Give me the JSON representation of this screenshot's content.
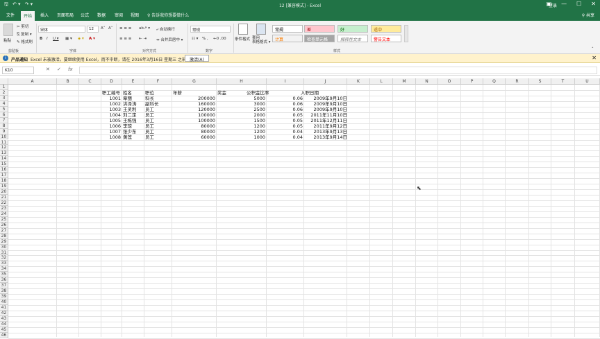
{
  "titlebar": {
    "save_icon": "save-icon",
    "undo_icon": "undo-icon",
    "redo_icon": "redo-icon",
    "title": "12 [兼容模式] - Excel",
    "login": "登录",
    "min": "—",
    "max": "☐",
    "close": "✕"
  },
  "tabs": {
    "items": [
      "文件",
      "开始",
      "插入",
      "页面布局",
      "公式",
      "数据",
      "审阅",
      "视图"
    ],
    "tell": "♀ 告诉我你想要做什么",
    "share": "⚲ 共享"
  },
  "ribbon": {
    "paste": "粘贴",
    "cut": "✂ 剪切",
    "copy": "⎘ 复制 ▾",
    "painter": "✎ 格式刷",
    "font_name": "宋体",
    "font_size": "12",
    "grow": "A˄",
    "shrink": "A˅",
    "bold": "B",
    "italic": "I",
    "underline": "U ▾",
    "wrap": "⤶ 自动换行",
    "merge": "⇔ 合并后居中 ▾",
    "number_format": "常规",
    "percent": "% ,",
    "dec": "←0 .00",
    "cond_format": "条件格式",
    "table_format": "套用\n表格格式 ▾",
    "styles": [
      {
        "label": "常规",
        "bg": "#ffffff",
        "fg": "#000000"
      },
      {
        "label": "差",
        "bg": "#ffc7ce",
        "fg": "#9c0006"
      },
      {
        "label": "好",
        "bg": "#c6efce",
        "fg": "#006100"
      },
      {
        "label": "适中",
        "bg": "#ffeb9c",
        "fg": "#9c5700"
      },
      {
        "label": "计算",
        "bg": "#f2f2f2",
        "fg": "#fa7d00"
      },
      {
        "label": "检查单元格",
        "bg": "#a5a5a5",
        "fg": "#ffffff"
      },
      {
        "label": "解释性文本",
        "bg": "#ffffff",
        "fg": "#7f7f7f"
      },
      {
        "label": "警告文本",
        "bg": "#ffffff",
        "fg": "#ff0000"
      }
    ],
    "groups": {
      "clipboard": "剪贴板",
      "font": "字体",
      "align": "对齐方式",
      "number": "数字",
      "styles": "样式"
    }
  },
  "notice": {
    "title": "产品通知",
    "text": "Excel 未被激活。要继续使用 Excel，而不中断，请在 2016年3月16日 星期三 之前激活。",
    "button": "激活(A)",
    "close": "✕"
  },
  "formula_bar": {
    "name_box": "K10",
    "cancel": "✕",
    "enter": "✓",
    "fx": "fx",
    "value": ""
  },
  "columns": [
    "A",
    "B",
    "C",
    "D",
    "E",
    "F",
    "G",
    "H",
    "I",
    "J",
    "K",
    "L",
    "M",
    "N",
    "O",
    "P",
    "Q",
    "R",
    "S",
    "T",
    "U"
  ],
  "rows": [
    "1",
    "2",
    "3",
    "4",
    "5",
    "6",
    "7",
    "8",
    "9",
    "10",
    "11",
    "12",
    "13",
    "14",
    "15",
    "16",
    "17",
    "18",
    "19",
    "20",
    "21",
    "22",
    "23",
    "24",
    "25",
    "26",
    "27",
    "28",
    "29",
    "30",
    "31",
    "32",
    "33",
    "34",
    "35",
    "36",
    "37",
    "38",
    "39",
    "40",
    "41",
    "42",
    "43",
    "44",
    "45",
    "46"
  ],
  "sheet": {
    "headers": [
      "职工编号",
      "姓名",
      "职位",
      "年薪",
      "奖金",
      "公积金比率",
      "入职日期"
    ],
    "rows": [
      [
        "1001",
        "章丽",
        "科长",
        "200000",
        "5000",
        "0.06",
        "2009年9月10日"
      ],
      [
        "1002",
        "洪泽涛",
        "副科长",
        "160000",
        "3000",
        "0.06",
        "2009年9月10日"
      ],
      [
        "1003",
        "王灵利",
        "员工",
        "120000",
        "2500",
        "0.06",
        "2009年9月10日"
      ],
      [
        "1004",
        "刘二定",
        "员工",
        "100000",
        "2000",
        "0.05",
        "2011年11月10日"
      ],
      [
        "1005",
        "王栋强",
        "员工",
        "100000",
        "1500",
        "0.05",
        "2011年12月11日"
      ],
      [
        "1006",
        "李琼",
        "员工",
        "80000",
        "1200",
        "0.05",
        "2011年9月12日"
      ],
      [
        "1007",
        "张少东",
        "员工",
        "80000",
        "1200",
        "0.04",
        "2013年9月13日"
      ],
      [
        "1008",
        "黄莲",
        "员工",
        "60000",
        "1000",
        "0.04",
        "2013年9月14日"
      ]
    ]
  }
}
